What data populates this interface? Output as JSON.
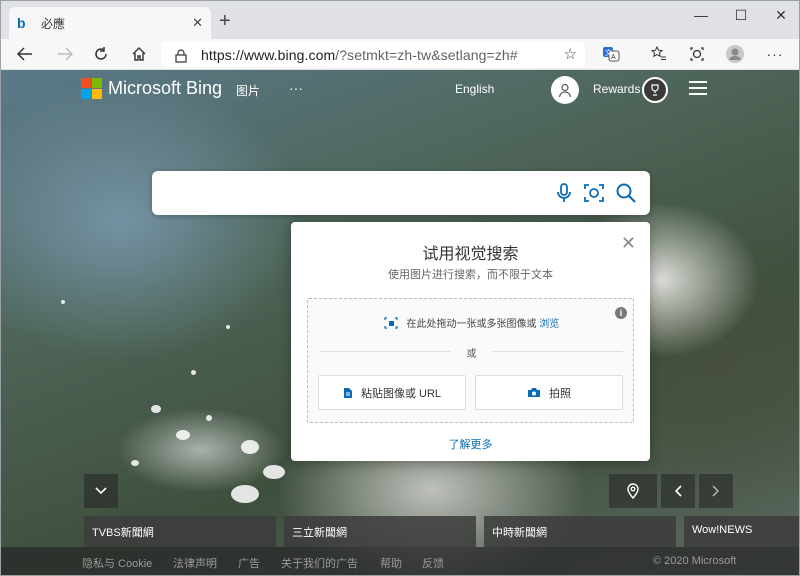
{
  "browser": {
    "tab": {
      "favicon": "b",
      "title": "必應",
      "close": "✕"
    },
    "new_tab": "+",
    "window_controls": {
      "minimize": "—",
      "maximize": "☐",
      "close": "✕"
    },
    "address": {
      "url_main": "https://www.bing.com",
      "url_rest": "/?setmkt=zh-tw&setlang=zh#"
    }
  },
  "header": {
    "brand": "Microsoft Bing",
    "nav_images": "图片",
    "nav_more": "···",
    "language": "English",
    "rewards": "Rewards"
  },
  "visual_search": {
    "title": "试用视觉搜索",
    "subtitle": "使用图片进行搜索，而不限于文本",
    "drag_text": "在此处拖动一张或多张图像或",
    "browse": "浏览",
    "info": "i",
    "or": "或",
    "paste_button": "粘贴图像或 URL",
    "camera_button": "拍照",
    "learn_more": "了解更多"
  },
  "news": [
    "TVBS新聞網",
    "三立新聞網",
    "中時新聞網",
    "Wow!NEWS"
  ],
  "footer": {
    "links": [
      "隐私与 Cookie",
      "法律声明",
      "广告",
      "关于我们的广告",
      "帮助",
      "反馈"
    ],
    "copyright": "© 2020 Microsoft"
  },
  "colors": {
    "accent": "#0b6cb5",
    "ms_red": "#f25022",
    "ms_green": "#7fba00",
    "ms_blue": "#00a4ef",
    "ms_yellow": "#ffb900"
  }
}
